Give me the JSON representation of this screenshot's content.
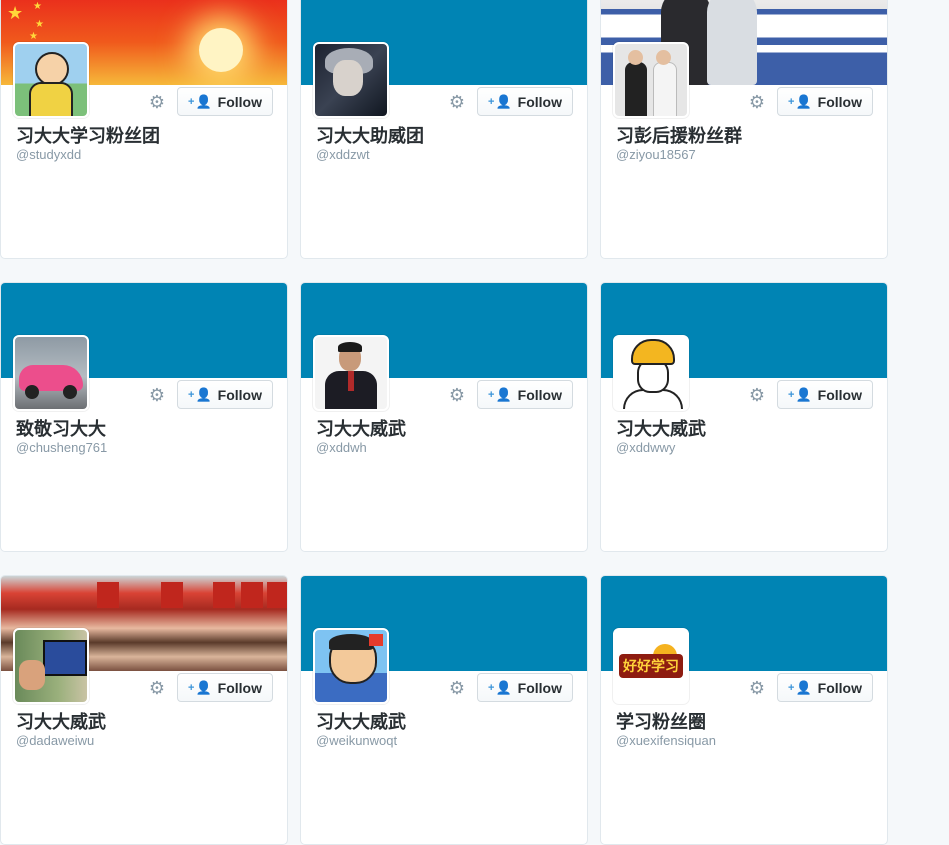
{
  "follow_label": "Follow",
  "colors": {
    "header_blue": "#0084b4",
    "follow_icon": "#3b94d9",
    "name_text": "#292f33",
    "muted_text": "#8899a6"
  },
  "icons": {
    "gear": "gear-icon",
    "follow": "add-user-icon"
  },
  "cards": [
    {
      "fullname": "习大大学习粉丝团",
      "screen_name": "@studyxdd",
      "banner": "flag"
    },
    {
      "fullname": "习大大助威团",
      "screen_name": "@xddzwt",
      "banner": "blue"
    },
    {
      "fullname": "习彭后援粉丝群",
      "screen_name": "@ziyou18567",
      "banner": "cartoon"
    },
    {
      "fullname": "致敬习大大",
      "screen_name": "@chusheng761",
      "banner": "blue"
    },
    {
      "fullname": "习大大威武",
      "screen_name": "@xddwh",
      "banner": "blue"
    },
    {
      "fullname": "习大大威武",
      "screen_name": "@xddwwy",
      "banner": "blue"
    },
    {
      "fullname": "习大大威武",
      "screen_name": "@dadaweiwu",
      "banner": "crowd"
    },
    {
      "fullname": "习大大威武",
      "screen_name": "@weikunwoqt",
      "banner": "blue"
    },
    {
      "fullname": "学习粉丝圈",
      "screen_name": "@xuexifensiquan",
      "banner": "blue"
    }
  ]
}
